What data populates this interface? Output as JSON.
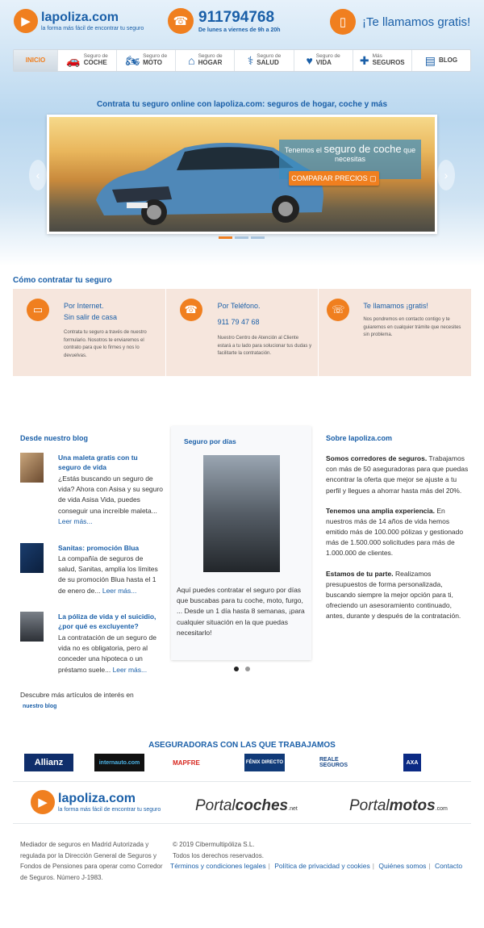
{
  "header": {
    "logo_name": "lapoliza.com",
    "logo_tagline": "la forma más fácil de encontrar tu seguro",
    "phone_number": "911794768",
    "phone_hours": "De lunes a viernes de 9h a 20h",
    "callback_text": "¡Te llamamos gratis!"
  },
  "nav": {
    "items": [
      {
        "small": "",
        "big": "INICIO"
      },
      {
        "small": "Seguro de",
        "big": "COCHE"
      },
      {
        "small": "Seguro de",
        "big": "MOTO"
      },
      {
        "small": "Seguro de",
        "big": "HOGAR"
      },
      {
        "small": "Seguro de",
        "big": "SALUD"
      },
      {
        "small": "Seguro de",
        "big": "VIDA"
      },
      {
        "small": "Más",
        "big": "SEGUROS"
      },
      {
        "small": "",
        "big": "BLOG"
      }
    ]
  },
  "hero": {
    "title": "Contrata tu seguro online con lapoliza.com: seguros de hogar, coche y más",
    "slide_line1": "Tenemos el",
    "slide_big": "seguro de coche",
    "slide_line1_end": "que",
    "slide_line2": "necesitas",
    "slide_button": "COMPARAR PRECIOS"
  },
  "how": {
    "title": "Cómo contratar tu seguro",
    "cols": [
      {
        "head1": "Por Internet.",
        "head2": "Sin salir de casa",
        "text": "Contrata tu seguro a través de nuestro formulario. Nosotros te enviaremos el contrato para que lo firmes y nos lo devuelvas."
      },
      {
        "head1": "Por Teléfono.",
        "head2": "911 79 47 68",
        "text": "Nuestro Centro de Atención al Cliente estará a tu lado para solucionar tus dudas y facilitarte la contratación."
      },
      {
        "head1": "Te llamamos ¡gratis!",
        "head2": "",
        "text": "Nos pondremos en contacto contigo y te guiaremos en cualquier trámite que necesites sin problema."
      }
    ]
  },
  "blog": {
    "title": "Desde nuestro blog",
    "read_more": "Leer más...",
    "posts": [
      {
        "title": "Una maleta gratis con tu seguro de vida",
        "body": "¿Estás buscando un seguro de vida? Ahora con Asisa y su seguro de vida Asisa Vida, puedes conseguir una increíble maleta..."
      },
      {
        "title": "Sanitas: promoción Blua",
        "body": "La compañía de seguros de salud, Sanitas, amplía los límites de su promoción Blua hasta el 1 de enero de..."
      },
      {
        "title": "La póliza de vida y el suicidio, ¿por qué es excluyente?",
        "body": "La contratación de un seguro de vida no es obligatoria, pero al conceder una hipoteca o un préstamo suele..."
      }
    ],
    "discover": "Descubre más artículos de interés en",
    "discover_link": "nuestro blog"
  },
  "card": {
    "title": "Seguro por días",
    "text": "Aquí puedes contratar el seguro por días que buscabas para tu coche, moto, furgo, ... Desde un 1 día hasta 8 semanas, ¡para cualquier situación en la que puedas necesitarlo!"
  },
  "about": {
    "title": "Sobre lapoliza.com",
    "p1_bold": "Somos corredores de seguros.",
    "p1": "Trabajamos con más de 50 aseguradoras para que puedas encontrar la oferta que mejor se ajuste a tu perfil y llegues a ahorrar hasta más del 20%.",
    "p2_bold": "Tenemos una amplia experiencia.",
    "p2": "En nuestros más de 14 años de vida hemos emitido más de 100.000 pólizas y gestionado más de 1.500.000 solicitudes para más de 1.000.000 de clientes.",
    "p3_bold": "Estamos de tu parte.",
    "p3": "Realizamos presupuestos de forma personalizada, buscando siempre la mejor opción para ti, ofreciendo un asesoramiento continuado, antes, durante y después de la contratación."
  },
  "insurers": {
    "title": "ASEGURADORAS CON LAS QUE TRABAJAMOS",
    "logos": [
      "Allianz",
      "internauto.com",
      "MAPFRE",
      "FÉNIX DIRECTO",
      "REALE SEGUROS",
      "AXA"
    ]
  },
  "footer": {
    "portal1": "Portal",
    "portal1_b": "coches",
    "portal1_s": ".net",
    "portal2": "Portal",
    "portal2_b": "motos",
    "portal2_s": ".com",
    "legal": "Mediador de seguros en Madrid Autorizada y regulada por la Dirección General de Seguros y Fondos de Pensiones para operar como Corredor de Seguros. Número J-1983.",
    "copyright1": "© 2019 Cibermultipóliza S.L.",
    "copyright2": "Todos los derechos reservados.",
    "links": [
      "Términos y condiciones legales",
      "Política de privacidad y cookies",
      "Quiénes somos",
      "Contacto"
    ]
  },
  "colors": {
    "brand_blue": "#1a5fa8",
    "accent_orange": "#f07f1f"
  }
}
